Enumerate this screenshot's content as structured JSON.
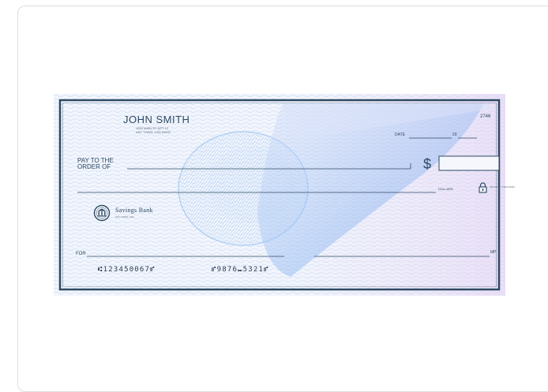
{
  "check": {
    "payer_name": "JOHN SMITH",
    "payer_address_line1": "1000 MAIN ST. APT 12",
    "payer_address_line2": "ANY TOWN, USA 00000",
    "check_number": "2746",
    "date_label": "DATE",
    "date_separator": "20",
    "pay_to_line1": "PAY TO THE",
    "pay_to_line2": "ORDER OF",
    "dollar_sign": "$",
    "dollars_label": "DOLLARS",
    "security_note": "SECURITY FEATURES",
    "bank_name": "Savings Bank",
    "bank_location": "ANY TOWN, USA",
    "memo_label": "FOR",
    "signature_label": "MP",
    "micr_routing": "⑆123450067⑈",
    "micr_account": "⑈9876⑉5321⑈"
  },
  "colors": {
    "border": "#2d4a63",
    "ink": "#2d4a63",
    "guilloche_light": "#bcd3f2",
    "guilloche_accent": "#7fb5f0",
    "fan_overlay": "#a9c6f3",
    "pink_tint": "#e7d6f3"
  },
  "icons": [
    "bank-seal-icon",
    "padlock-icon"
  ]
}
